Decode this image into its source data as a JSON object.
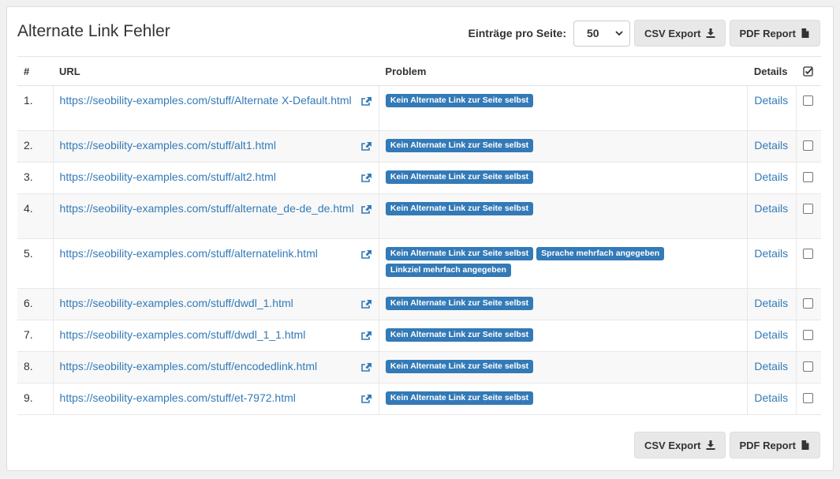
{
  "panel": {
    "title": "Alternate Link Fehler",
    "per_page_label": "Einträge pro Seite:",
    "per_page_value": "50",
    "csv_export": "CSV Export",
    "pdf_report": "PDF Report"
  },
  "table": {
    "headers": {
      "num": "#",
      "url": "URL",
      "problem": "Problem",
      "details": "Details"
    },
    "rows": [
      {
        "num": "1.",
        "url": "https://seobility-examples.com/stuff/Alternate X-Default.html",
        "problems": [
          "Kein Alternate Link zur Seite selbst"
        ],
        "details": "Details"
      },
      {
        "num": "2.",
        "url": "https://seobility-examples.com/stuff/alt1.html",
        "problems": [
          "Kein Alternate Link zur Seite selbst"
        ],
        "details": "Details"
      },
      {
        "num": "3.",
        "url": "https://seobility-examples.com/stuff/alt2.html",
        "problems": [
          "Kein Alternate Link zur Seite selbst"
        ],
        "details": "Details"
      },
      {
        "num": "4.",
        "url": "https://seobility-examples.com/stuff/alternate_de-de_de.html",
        "problems": [
          "Kein Alternate Link zur Seite selbst"
        ],
        "details": "Details"
      },
      {
        "num": "5.",
        "url": "https://seobility-examples.com/stuff/alternatelink.html",
        "problems": [
          "Kein Alternate Link zur Seite selbst",
          "Sprache mehrfach angegeben",
          "Linkziel mehrfach angegeben"
        ],
        "details": "Details"
      },
      {
        "num": "6.",
        "url": "https://seobility-examples.com/stuff/dwdl_1.html",
        "problems": [
          "Kein Alternate Link zur Seite selbst"
        ],
        "details": "Details"
      },
      {
        "num": "7.",
        "url": "https://seobility-examples.com/stuff/dwdl_1_1.html",
        "problems": [
          "Kein Alternate Link zur Seite selbst"
        ],
        "details": "Details"
      },
      {
        "num": "8.",
        "url": "https://seobility-examples.com/stuff/encodedlink.html",
        "problems": [
          "Kein Alternate Link zur Seite selbst"
        ],
        "details": "Details"
      },
      {
        "num": "9.",
        "url": "https://seobility-examples.com/stuff/et-7972.html",
        "problems": [
          "Kein Alternate Link zur Seite selbst"
        ],
        "details": "Details"
      }
    ]
  },
  "colors": {
    "link": "#337ab7",
    "label_bg": "#337ab7",
    "button_bg": "#e8e8e8"
  },
  "icons": {
    "external": "share-icon",
    "download": "download-icon",
    "pdf": "file-icon",
    "check_all": "check-square-icon"
  }
}
